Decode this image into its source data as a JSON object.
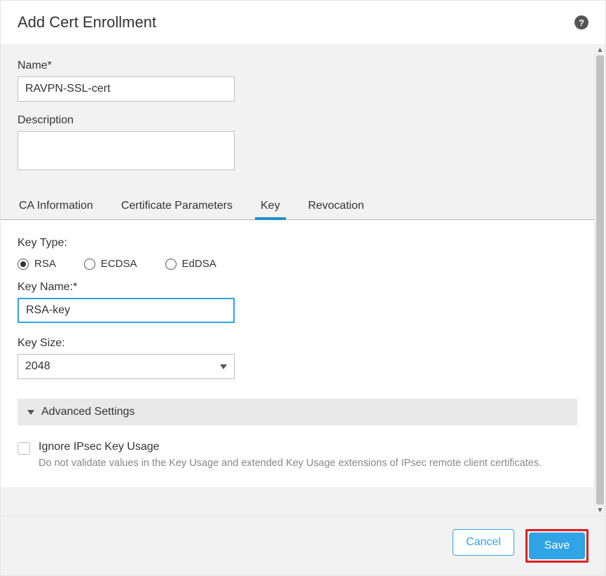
{
  "dialog": {
    "title": "Add Cert Enrollment"
  },
  "form": {
    "name_label": "Name*",
    "name_value": "RAVPN-SSL-cert",
    "description_label": "Description",
    "description_value": ""
  },
  "tabs": {
    "items": [
      {
        "label": "CA Information"
      },
      {
        "label": "Certificate Parameters"
      },
      {
        "label": "Key"
      },
      {
        "label": "Revocation"
      }
    ],
    "active_index": 2
  },
  "key": {
    "type_label": "Key Type:",
    "types": [
      {
        "label": "RSA",
        "selected": true
      },
      {
        "label": "ECDSA",
        "selected": false
      },
      {
        "label": "EdDSA",
        "selected": false
      }
    ],
    "name_label": "Key Name:*",
    "name_value": "RSA-key",
    "size_label": "Key Size:",
    "size_value": "2048"
  },
  "advanced": {
    "header": "Advanced Settings",
    "ignore_label": "Ignore IPsec Key Usage",
    "ignore_desc": "Do not validate values in the Key Usage and extended Key Usage extensions of IPsec remote client certificates.",
    "ignore_checked": false
  },
  "footer": {
    "cancel": "Cancel",
    "save": "Save"
  }
}
